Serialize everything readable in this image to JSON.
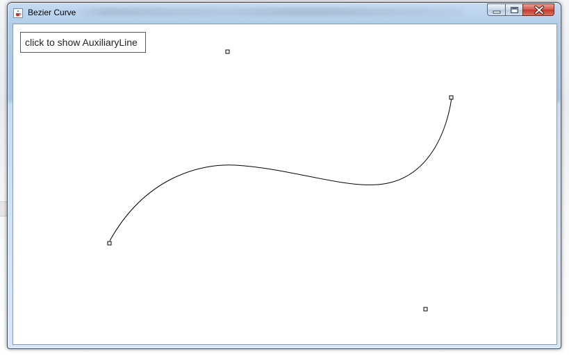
{
  "window": {
    "title": "Bezier Curve",
    "icon": "java-cup-icon"
  },
  "caption_buttons": [
    {
      "name": "minimize-button",
      "icon": "minimize-icon"
    },
    {
      "name": "maximize-button",
      "icon": "maximize-icon"
    },
    {
      "name": "close-button",
      "icon": "close-icon"
    }
  ],
  "toolbar": {
    "aux_button_label": "click to show AuxiliaryLine"
  },
  "curve": {
    "type": "cubic-bezier",
    "stroke_color": "#000000",
    "handle_color": "#000000"
  }
}
